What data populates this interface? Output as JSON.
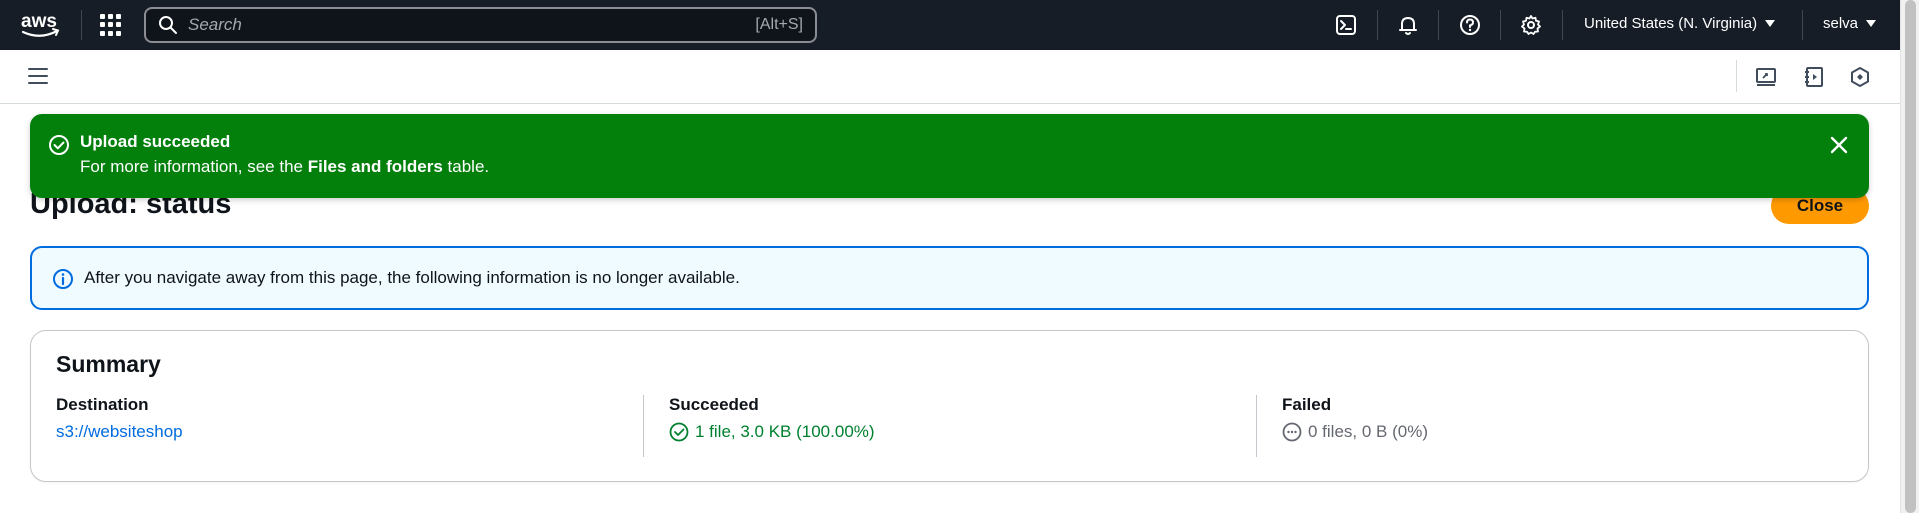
{
  "topnav": {
    "logo_text": "aws",
    "search": {
      "placeholder": "Search",
      "shortcut": "[Alt+S]"
    },
    "icons": [
      "cloudshell-icon",
      "bell-icon",
      "help-icon",
      "gear-icon"
    ],
    "region": "United States (N. Virginia)",
    "user": "selva"
  },
  "flash": {
    "title": "Upload succeeded",
    "body_prefix": "For more information, see the ",
    "body_bold": "Files and folders",
    "body_suffix": " table.",
    "color": "#037f0c"
  },
  "header": {
    "title": "Upload: status",
    "close_label": "Close"
  },
  "info_alert": {
    "text": "After you navigate away from this page, the following information is no longer available."
  },
  "summary": {
    "title": "Summary",
    "destination": {
      "label": "Destination",
      "value": "s3://websiteshop"
    },
    "succeeded": {
      "label": "Succeeded",
      "value": "1 file, 3.0 KB (100.00%)"
    },
    "failed": {
      "label": "Failed",
      "value": "0 files, 0 B (0%)"
    }
  },
  "colors": {
    "nav_bg": "#161d26",
    "accent": "#ff9900",
    "link": "#006ce0",
    "success": "#00802f"
  }
}
